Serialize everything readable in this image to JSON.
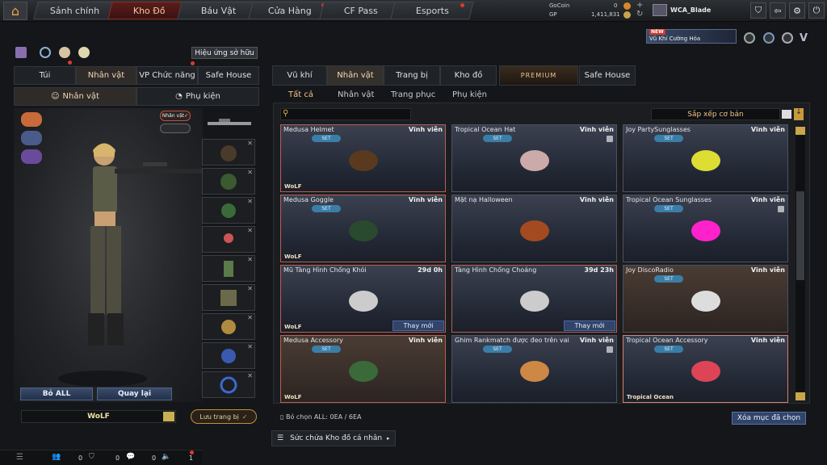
{
  "topnav": {
    "tabs": [
      {
        "label": "Sảnh chính"
      },
      {
        "label": "Kho Đồ"
      },
      {
        "label": "Báu Vật"
      },
      {
        "label": "Cửa Hàng"
      },
      {
        "label": "CF Pass"
      },
      {
        "label": "Esports"
      }
    ],
    "currency": {
      "gocoin_label": "GoCoin",
      "gocoin_value": "0",
      "gp_label": "GP",
      "gp_value": "1,411,831"
    },
    "player_name": "WCA_Blade",
    "promo": {
      "badge": "NEW",
      "text": "Vũ Khí Cường Hóa"
    }
  },
  "left": {
    "ownership_effect_label": "Hiệu ứng sở hữu",
    "tabs": [
      "Túi",
      "Nhân vật",
      "VP Chức năng",
      "Safe House"
    ],
    "subtabs": [
      "Nhân vật",
      "Phụ kiện"
    ],
    "character_toggle": "Nhân vật",
    "bo_all": "Bỏ ALL",
    "quay_lai": "Quay lại",
    "clan_name": "WoLF",
    "save_label": "Lưu trang bị"
  },
  "right": {
    "tabs": [
      "Vũ khí",
      "Nhân vật",
      "Trang bị",
      "Kho đồ",
      "PREMIUM",
      "Safe House"
    ],
    "subtabs": [
      "Tất cả",
      "Nhân vật",
      "Trang phục",
      "Phụ kiện"
    ],
    "sort_label": "Sắp xếp cơ bản",
    "items": [
      {
        "name": "Medusa Helmet",
        "time": "Vĩnh viễn",
        "set": "SET",
        "owner": "WoLF",
        "change": ""
      },
      {
        "name": "Tropical Ocean Hat",
        "time": "Vĩnh viễn",
        "set": "SET",
        "owner": "",
        "change": ""
      },
      {
        "name": "Joy PartySunglasses",
        "time": "Vĩnh viễn",
        "set": "SET",
        "owner": "",
        "change": ""
      },
      {
        "name": "Medusa Goggle",
        "time": "Vĩnh viễn",
        "set": "SET",
        "owner": "WoLF",
        "change": ""
      },
      {
        "name": "Mặt nạ Halloween",
        "time": "Vĩnh viễn",
        "set": "",
        "owner": "",
        "change": ""
      },
      {
        "name": "Tropical Ocean Sunglasses",
        "time": "Vĩnh viễn",
        "set": "SET",
        "owner": "",
        "change": ""
      },
      {
        "name": "Mũ Tàng Hình Chống Khói",
        "time": "29d 0h",
        "set": "",
        "owner": "WoLF",
        "change": "Thay mới"
      },
      {
        "name": "Tàng Hình Chống Choáng",
        "time": "39d 23h",
        "set": "",
        "owner": "",
        "change": "Thay mới"
      },
      {
        "name": "Joy DiscoRadio",
        "time": "Vĩnh viễn",
        "set": "SET",
        "owner": "",
        "change": ""
      },
      {
        "name": "Medusa Accessory",
        "time": "Vĩnh viễn",
        "set": "SET",
        "owner": "WoLF",
        "change": ""
      },
      {
        "name": "Ghim Rankmatch được đeo trên vai",
        "time": "Vĩnh viễn",
        "set": "SET",
        "owner": "",
        "change": ""
      },
      {
        "name": "Tropical Ocean Accessory",
        "time": "Vĩnh viễn",
        "set": "SET",
        "owner": "Tropical Ocean",
        "change": ""
      }
    ],
    "selection_text": "Bỏ chọn ALL: 0EA / 6EA",
    "clear_selected": "Xóa mục đã chọn",
    "capacity_label": "Sức chứa Kho đồ cá nhân"
  },
  "bottombar": {
    "c1": "0",
    "c2": "0",
    "c3": "0",
    "c4": "1"
  }
}
